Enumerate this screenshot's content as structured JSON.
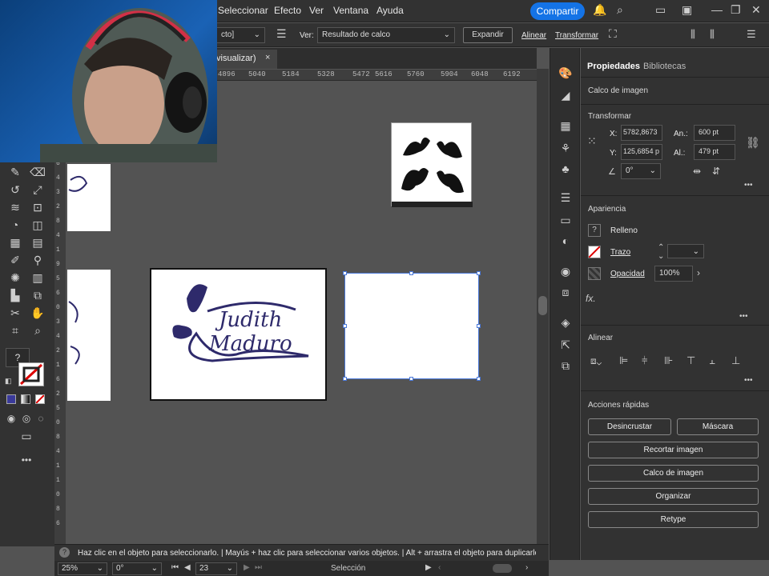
{
  "menubar": {
    "items": [
      "Seleccionar",
      "Efecto",
      "Ver",
      "Ventana",
      "Ayuda"
    ],
    "share_label": "Compartir"
  },
  "controlbar": {
    "preset_value": "cto]",
    "view_label": "Ver:",
    "view_value": "Resultado de calco",
    "expand_label": "Expandir",
    "align_label": "Alinear",
    "transform_label": "Transformar"
  },
  "document": {
    "tab_label": "visualizar)",
    "tab_close": "×"
  },
  "ruler": {
    "ticks": [
      "4896",
      "5040",
      "5184",
      "5328",
      "5472",
      "5616",
      "5760",
      "5904",
      "6048",
      "6192"
    ]
  },
  "vruler": {
    "ticks": [
      "6",
      "4",
      "3",
      "2",
      "8",
      "4",
      "1",
      "9",
      "5",
      "6",
      "0",
      "3",
      "4",
      "2",
      "1",
      "6",
      "2",
      "5",
      "0",
      "8",
      "4",
      "1",
      "1",
      "0",
      "8",
      "6"
    ]
  },
  "artwork": {
    "logo_line1": "Judith",
    "logo_line2": "Maduro"
  },
  "panel": {
    "tabs": [
      "Propiedades",
      "Bibliotecas"
    ],
    "object_type": "Calco de imagen",
    "transform": {
      "title": "Transformar",
      "x_label": "X:",
      "x_value": "5782,8673",
      "y_label": "Y:",
      "y_value": "125,6854 p",
      "w_label": "An.:",
      "w_value": "600 pt",
      "h_label": "Al.:",
      "h_value": "479 pt",
      "angle_value": "0°"
    },
    "appearance": {
      "title": "Apariencia",
      "fill_label": "Relleno",
      "stroke_label": "Trazo",
      "opacity_label": "Opacidad",
      "opacity_value": "100%",
      "fx_label": "fx."
    },
    "align": {
      "title": "Alinear"
    },
    "quick_actions": {
      "title": "Acciones rápidas",
      "buttons": [
        "Desincrustar",
        "Máscara",
        "Recortar imagen",
        "Calco de imagen",
        "Organizar",
        "Retype"
      ]
    },
    "more": "•••"
  },
  "status": {
    "hint": "Haz clic en el objeto para seleccionarlo. | Mayús + haz clic para seleccionar varios objetos. | Alt + arrastra el objeto para duplicarlo"
  },
  "bottombar": {
    "zoom": "25%",
    "rotation": "0°",
    "artboard": "23",
    "tool": "Selección"
  },
  "colors": {
    "accent": "#1473e6",
    "logo": "#2e2a6b",
    "ui_dark": "#323232",
    "canvas": "#535353"
  }
}
